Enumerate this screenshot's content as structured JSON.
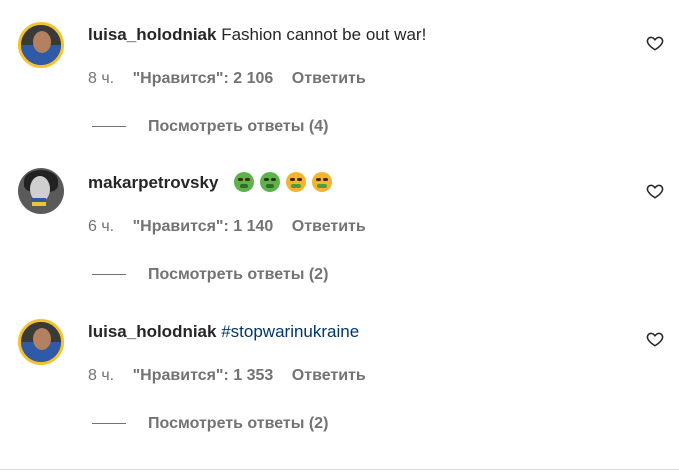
{
  "comments": [
    {
      "username": "luisa_holodniak",
      "text": "Fashion cannot be out war!",
      "hashtag": "",
      "emojis": [],
      "time": "8 ч.",
      "likes": "\"Нравится\": 2 106",
      "reply_label": "Ответить",
      "view_replies": "Посмотреть ответы (4)",
      "avatar_icon": "avatar-ukraine-frame"
    },
    {
      "username": "makarpetrovsky",
      "text": "",
      "hashtag": "",
      "emojis": [
        "nauseated-face",
        "nauseated-face",
        "vomiting-face",
        "vomiting-face"
      ],
      "time": "6 ч.",
      "likes": "\"Нравится\": 1 140",
      "reply_label": "Ответить",
      "view_replies": "Посмотреть ответы (2)",
      "avatar_icon": "avatar-bw-photo"
    },
    {
      "username": "luisa_holodniak",
      "text": "",
      "hashtag": "#stopwarinukraine",
      "emojis": [],
      "time": "8 ч.",
      "likes": "\"Нравится\": 1 353",
      "reply_label": "Ответить",
      "view_replies": "Посмотреть ответы (2)",
      "avatar_icon": "avatar-ukraine-frame"
    }
  ],
  "icons": {
    "like": "heart-outline-icon"
  },
  "colors": {
    "hashtag": "#00376b",
    "meta": "#737373",
    "text": "#262626",
    "ukraine_blue": "#2f5aa8",
    "ukraine_yellow": "#f2c230"
  }
}
